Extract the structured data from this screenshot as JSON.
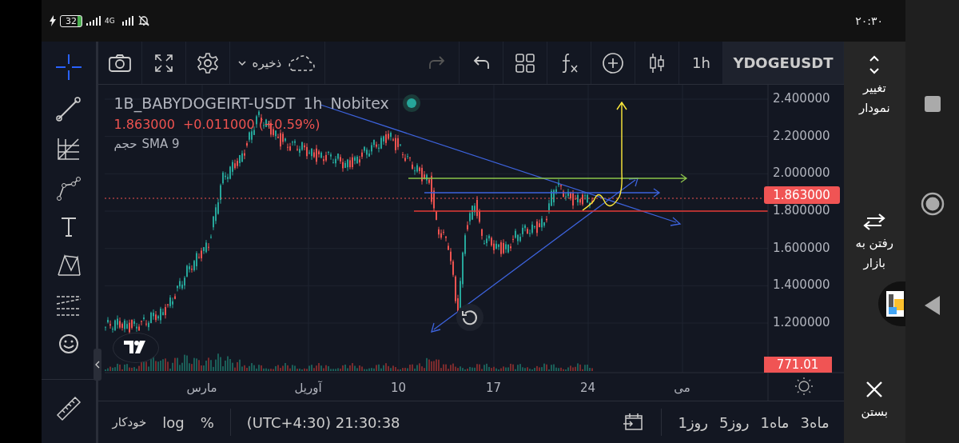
{
  "status_bar": {
    "battery": "32",
    "network": "4G",
    "time": "۲۰:۳۰"
  },
  "toolbar": {
    "save": "ذخیره",
    "interval": "1h",
    "symbol": "YDOGEUSDT"
  },
  "legend": {
    "symbol": "1B_BABYDOGEIRT-USDT",
    "interval": "1h",
    "exchange": "Nobitex",
    "live": true,
    "price": "1.863000",
    "change": "+0.011000",
    "change_percent": "(+0.59%)",
    "indicator_name": "حجم",
    "indicator": "SMA 9"
  },
  "price_axis": {
    "ticks": [
      "2.400000",
      "2.200000",
      "2.000000",
      "1.800000",
      "1.600000",
      "1.400000",
      "1.200000"
    ],
    "last_price": "1.863000",
    "volume_value": "771.01"
  },
  "time_axis": {
    "months": [
      "می",
      "آوریل",
      "مارس"
    ],
    "days": [
      "24",
      "17",
      "10"
    ]
  },
  "bottom_bar": {
    "ranges": [
      "3ماه",
      "1ماه",
      "5روز",
      "1روز"
    ],
    "clock": "(UTC+4:30) 21:30:38",
    "percent": "%",
    "log": "log",
    "auto": "خودکار"
  },
  "side_panel": {
    "switch_chart": "تغییر نمودار",
    "go_market": "رفتن به بازار",
    "close": "بستن"
  }
}
